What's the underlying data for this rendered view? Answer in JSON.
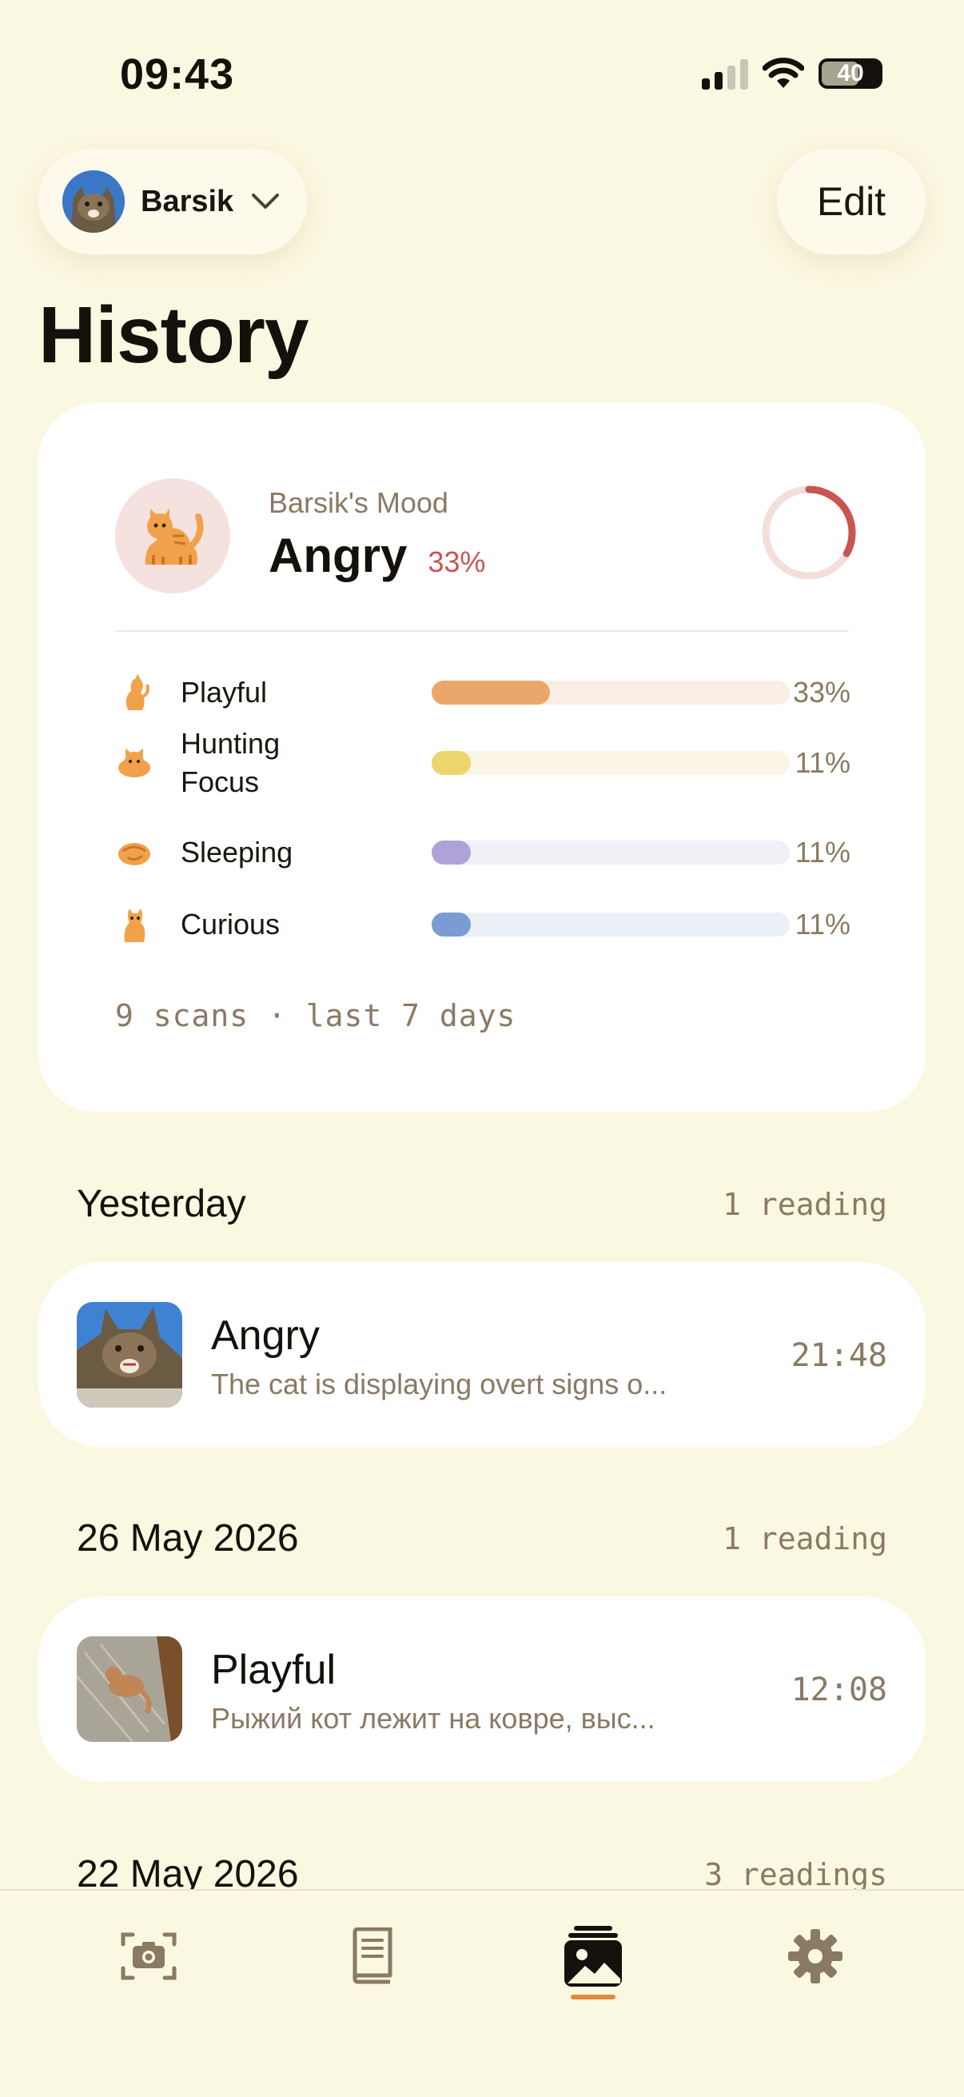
{
  "status_bar": {
    "time": "09:43",
    "battery": "40"
  },
  "header": {
    "pet_name": "Barsik",
    "edit_label": "Edit",
    "title": "History"
  },
  "mood_summary": {
    "subtitle": "Barsik's Mood",
    "mood": "Angry",
    "percent": "33%",
    "ring_fraction": 0.33,
    "breakdown": [
      {
        "label": "Playful",
        "value": "33%",
        "fraction": 0.33,
        "color": "#eba66b",
        "track": "#fbeee4",
        "icon": "cat-playful-icon"
      },
      {
        "label": "Hunting Focus",
        "value": "11%",
        "fraction": 0.11,
        "color": "#edd56c",
        "track": "#faf5e6",
        "icon": "cat-hunting-icon"
      },
      {
        "label": "Sleeping",
        "value": "11%",
        "fraction": 0.11,
        "color": "#aea2d9",
        "track": "#f0f0f6",
        "icon": "cat-sleeping-icon"
      },
      {
        "label": "Curious",
        "value": "11%",
        "fraction": 0.11,
        "color": "#7b9bd3",
        "track": "#ebeff6",
        "icon": "cat-curious-icon"
      }
    ],
    "scans_text": "9 scans · last 7 days"
  },
  "history": [
    {
      "title": "Yesterday",
      "count": "1 reading",
      "entries": [
        {
          "mood": "Angry",
          "description": "The cat is displaying overt signs o...",
          "time": "21:48"
        }
      ]
    },
    {
      "title": "26 May 2026",
      "count": "1 reading",
      "entries": [
        {
          "mood": "Playful",
          "description": "Рыжий кот лежит на ковре, выс...",
          "time": "12:08"
        }
      ]
    },
    {
      "title": "22 May 2026",
      "count": "3 readings",
      "entries": []
    }
  ],
  "tabs": [
    {
      "name": "camera",
      "icon": "camera-icon",
      "active": false
    },
    {
      "name": "guide",
      "icon": "book-icon",
      "active": false
    },
    {
      "name": "history",
      "icon": "gallery-icon",
      "active": true
    },
    {
      "name": "settings",
      "icon": "gear-icon",
      "active": false
    }
  ],
  "colors": {
    "background": "#fbf8e1",
    "accent": "#e08a3e",
    "angry": "#c8554f",
    "muted": "#8a7a62"
  }
}
